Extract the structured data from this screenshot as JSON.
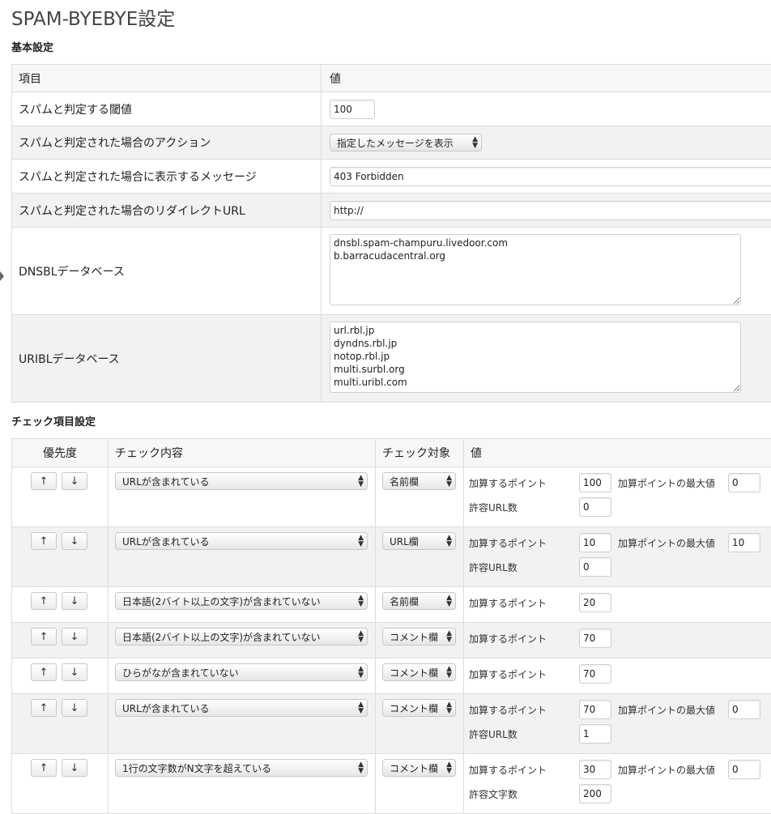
{
  "page": {
    "title": "SPAM-BYEBYE設定"
  },
  "basic": {
    "heading": "基本設定",
    "header": {
      "item": "項目",
      "value": "値"
    },
    "threshold": {
      "label": "スパムと判定する閾値",
      "value": "100"
    },
    "action": {
      "label": "スパムと判定された場合のアクション",
      "value": "指定したメッセージを表示"
    },
    "message": {
      "label": "スパムと判定された場合に表示するメッセージ",
      "value": "403 Forbidden"
    },
    "redirect": {
      "label": "スパムと判定された場合のリダイレクトURL",
      "value": "http://"
    },
    "dnsbl": {
      "label": "DNSBLデータベース",
      "value": "dnsbl.spam-champuru.livedoor.com\nb.barracudacentral.org"
    },
    "uribl": {
      "label": "URIBLデータベース",
      "value": "url.rbl.jp\ndyndns.rbl.jp\nnotop.rbl.jp\nmulti.surbl.org\nmulti.uribl.com"
    }
  },
  "checks": {
    "heading": "チェック項目設定",
    "header": {
      "priority": "優先度",
      "content": "チェック内容",
      "target": "チェック対象",
      "value": "値"
    },
    "up": "↑",
    "down": "↓",
    "rows": [
      {
        "content": "URLが含まれている",
        "target": "名前欄",
        "points_label": "加算するポイント",
        "points": "100",
        "max_label": "加算ポイントの最大値",
        "max": "0",
        "extra_label": "許容URL数",
        "extra": "0"
      },
      {
        "content": "URLが含まれている",
        "target": "URL欄",
        "points_label": "加算するポイント",
        "points": "10",
        "max_label": "加算ポイントの最大値",
        "max": "10",
        "extra_label": "許容URL数",
        "extra": "0"
      },
      {
        "content": "日本語(2バイト以上の文字)が含まれていない",
        "target": "名前欄",
        "points_label": "加算するポイント",
        "points": "20"
      },
      {
        "content": "日本語(2バイト以上の文字)が含まれていない",
        "target": "コメント欄",
        "points_label": "加算するポイント",
        "points": "70"
      },
      {
        "content": "ひらがなが含まれていない",
        "target": "コメント欄",
        "points_label": "加算するポイント",
        "points": "70"
      },
      {
        "content": "URLが含まれている",
        "target": "コメント欄",
        "points_label": "加算するポイント",
        "points": "70",
        "max_label": "加算ポイントの最大値",
        "max": "0",
        "extra_label": "許容URL数",
        "extra": "1"
      },
      {
        "content": "1行の文字数がN文字を超えている",
        "target": "コメント欄",
        "points_label": "加算するポイント",
        "points": "30",
        "max_label": "加算ポイントの最大値",
        "max": "0",
        "extra_label": "許容文字数",
        "extra": "200"
      }
    ]
  }
}
